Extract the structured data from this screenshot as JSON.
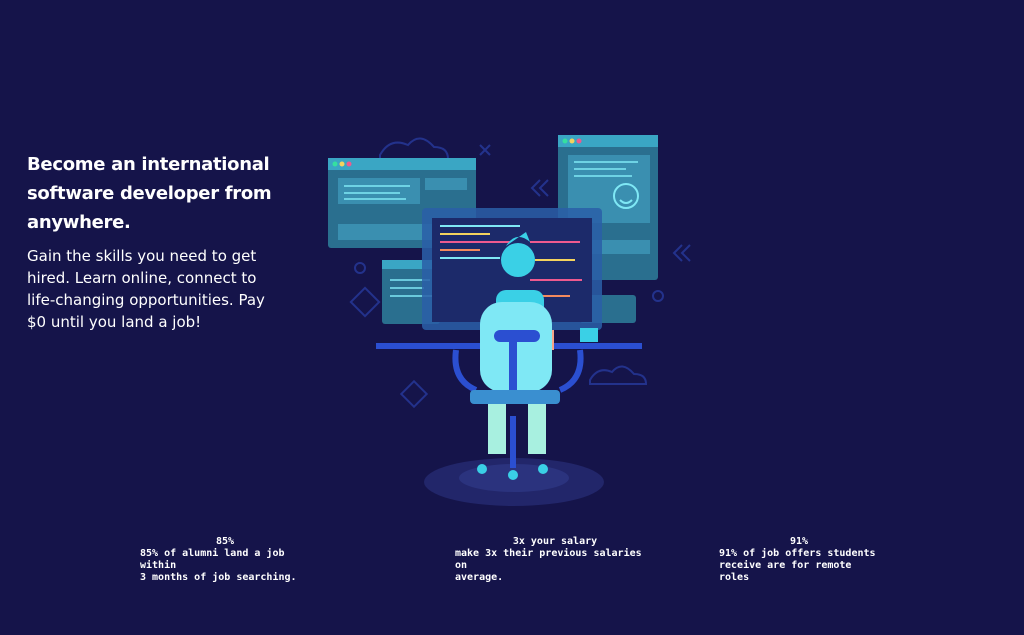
{
  "hero": {
    "headline": "Become an international software developer from anywhere.",
    "subtext": "Gain the skills you need to get hired. Learn online, connect to life-changing opportunities. Pay $0 until you land a job!"
  },
  "stats": [
    {
      "value": "85%",
      "description": "85% of alumni land a job within\n3 months of job searching."
    },
    {
      "value": "3x your salary",
      "description": "make 3x their previous salaries on\naverage."
    },
    {
      "value": "91%",
      "description": "91% of job offers students\nreceive are for remote roles"
    }
  ],
  "colors": {
    "background": "#15144a",
    "accent": "#3ad0e6",
    "panel": "#2a6f8f",
    "chair": "#2b4fd1"
  },
  "illustration": {
    "icon": "developer-at-computer-illustration"
  }
}
